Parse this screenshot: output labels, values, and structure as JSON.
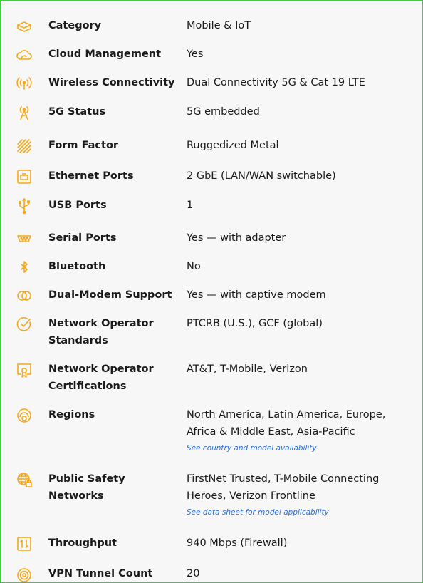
{
  "colors": {
    "accent": "#f5a81c",
    "link": "#2a6fdb",
    "frame": "#3ccf3c"
  },
  "specs": [
    {
      "icon": "category-icon",
      "label": "Category",
      "value": "Mobile & IoT"
    },
    {
      "icon": "cloud-icon",
      "label": "Cloud Management",
      "value": "Yes"
    },
    {
      "icon": "wireless-signal-icon",
      "label": "Wireless Connectivity",
      "value": "Dual Connectivity 5G & Cat 19 LTE"
    },
    {
      "icon": "antenna-tower-icon",
      "label": "5G Status",
      "value": "5G embedded"
    },
    {
      "icon": "rugged-form-factor-icon",
      "label": "Form Factor",
      "value": "Ruggedized Metal"
    },
    {
      "icon": "ethernet-port-icon",
      "label": "Ethernet Ports",
      "value": "2 GbE (LAN/WAN switchable)"
    },
    {
      "icon": "usb-icon",
      "label": "USB Ports",
      "value": "1"
    },
    {
      "icon": "serial-port-icon",
      "label": "Serial Ports",
      "value": "Yes — with adapter"
    },
    {
      "icon": "bluetooth-icon",
      "label": "Bluetooth",
      "value": "No"
    },
    {
      "icon": "dual-modem-icon",
      "label": "Dual-Modem Support",
      "value": "Yes — with captive modem"
    },
    {
      "icon": "checkmark-circle-icon",
      "label": "Network Operator Standards",
      "value": "PTCRB (U.S.), GCF (global)"
    },
    {
      "icon": "certificate-icon",
      "label": "Network Operator Certifications",
      "value": "AT&T, T-Mobile, Verizon"
    },
    {
      "icon": "regions-icon",
      "label": "Regions",
      "value": "North America, Latin America, Europe, Africa & Middle East, Asia-Pacific",
      "link": "See country and model availability"
    },
    {
      "icon": "globe-lock-icon",
      "label": "Public Safety Networks",
      "value": "FirstNet Trusted, T-Mobile Connecting Heroes, Verizon Frontline",
      "link": "See data sheet for model applicability"
    },
    {
      "icon": "throughput-icon",
      "label": "Throughput",
      "value": "940 Mbps (Firewall)"
    },
    {
      "icon": "vpn-tunnel-icon",
      "label": "VPN Tunnel Count",
      "value": "20"
    }
  ]
}
